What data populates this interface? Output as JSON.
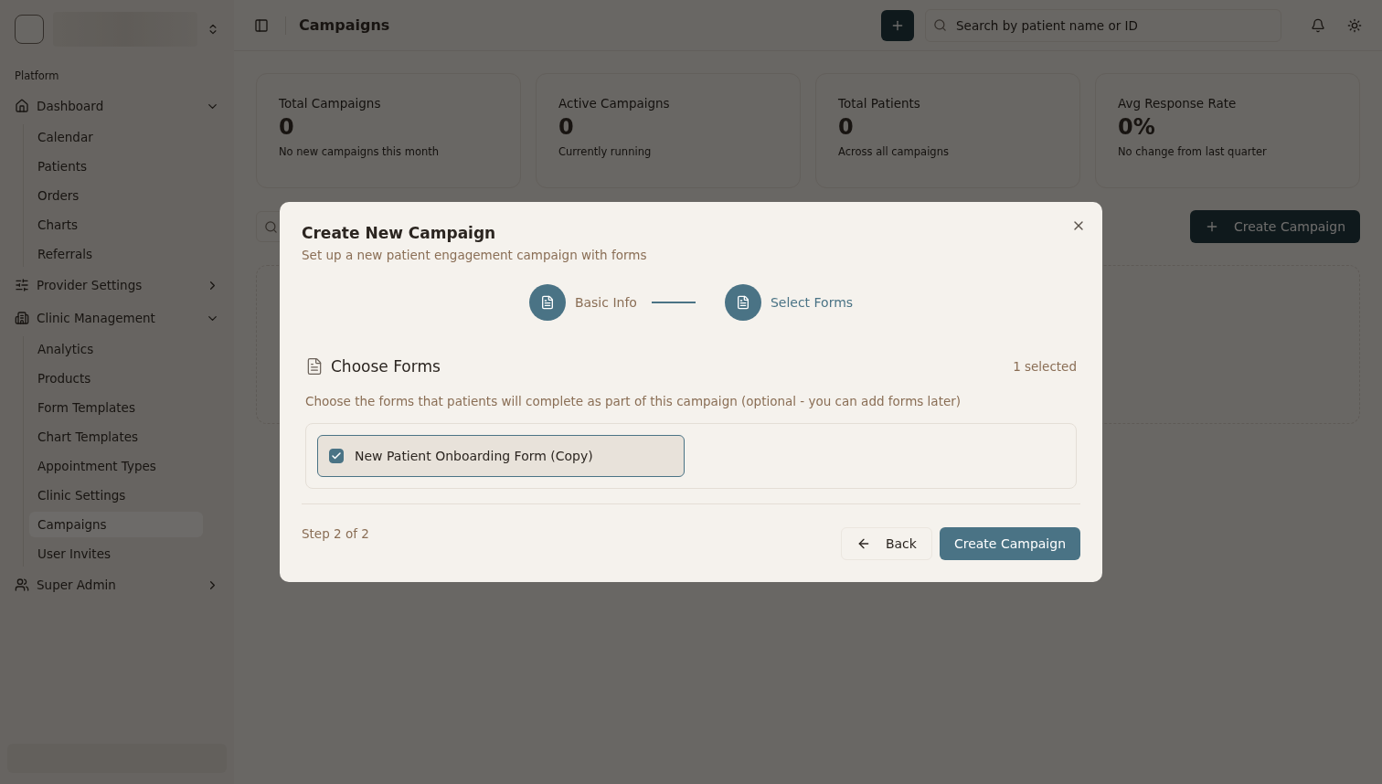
{
  "sidebar": {
    "section_label": "Platform",
    "items": [
      {
        "label": "Dashboard",
        "expanded": true,
        "children": [
          {
            "label": "Calendar",
            "selected": false
          },
          {
            "label": "Patients",
            "selected": false
          },
          {
            "label": "Orders",
            "selected": false
          },
          {
            "label": "Charts",
            "selected": false
          },
          {
            "label": "Referrals",
            "selected": false
          }
        ]
      },
      {
        "label": "Provider Settings",
        "expanded": false
      },
      {
        "label": "Clinic Management",
        "expanded": true,
        "children": [
          {
            "label": "Analytics",
            "selected": false
          },
          {
            "label": "Products",
            "selected": false
          },
          {
            "label": "Form Templates",
            "selected": false
          },
          {
            "label": "Chart Templates",
            "selected": false
          },
          {
            "label": "Appointment Types",
            "selected": false
          },
          {
            "label": "Clinic Settings",
            "selected": false
          },
          {
            "label": "Campaigns",
            "selected": true
          },
          {
            "label": "User Invites",
            "selected": false
          }
        ]
      },
      {
        "label": "Super Admin",
        "expanded": false
      }
    ]
  },
  "header": {
    "title": "Campaigns",
    "search": {
      "placeholder": "Search by patient name or ID"
    }
  },
  "stats": [
    {
      "label": "Total Campaigns",
      "value": "0",
      "note": "No new campaigns this month"
    },
    {
      "label": "Active Campaigns",
      "value": "0",
      "note": "Currently running"
    },
    {
      "label": "Total Patients",
      "value": "0",
      "note": "Across all campaigns"
    },
    {
      "label": "Avg Response Rate",
      "value": "0%",
      "note": "No change from last quarter"
    }
  ],
  "toolbar": {
    "button": "Create Campaign"
  },
  "dialog": {
    "title": "Create New Campaign",
    "subtitle": "Set up a new patient engagement campaign with forms",
    "steps": [
      {
        "label": "Basic Info",
        "selected": false
      },
      {
        "label": "Select Forms",
        "selected": true
      }
    ],
    "section": {
      "title": "Choose Forms",
      "count": "1 selected",
      "description": "Choose the forms that patients will complete as part of this campaign (optional - you can add forms later)"
    },
    "forms": [
      {
        "label": "New Patient Onboarding Form (Copy)",
        "checked": true
      }
    ],
    "step_text": "Step 2 of 2",
    "back": "Back",
    "submit": "Create Campaign"
  }
}
